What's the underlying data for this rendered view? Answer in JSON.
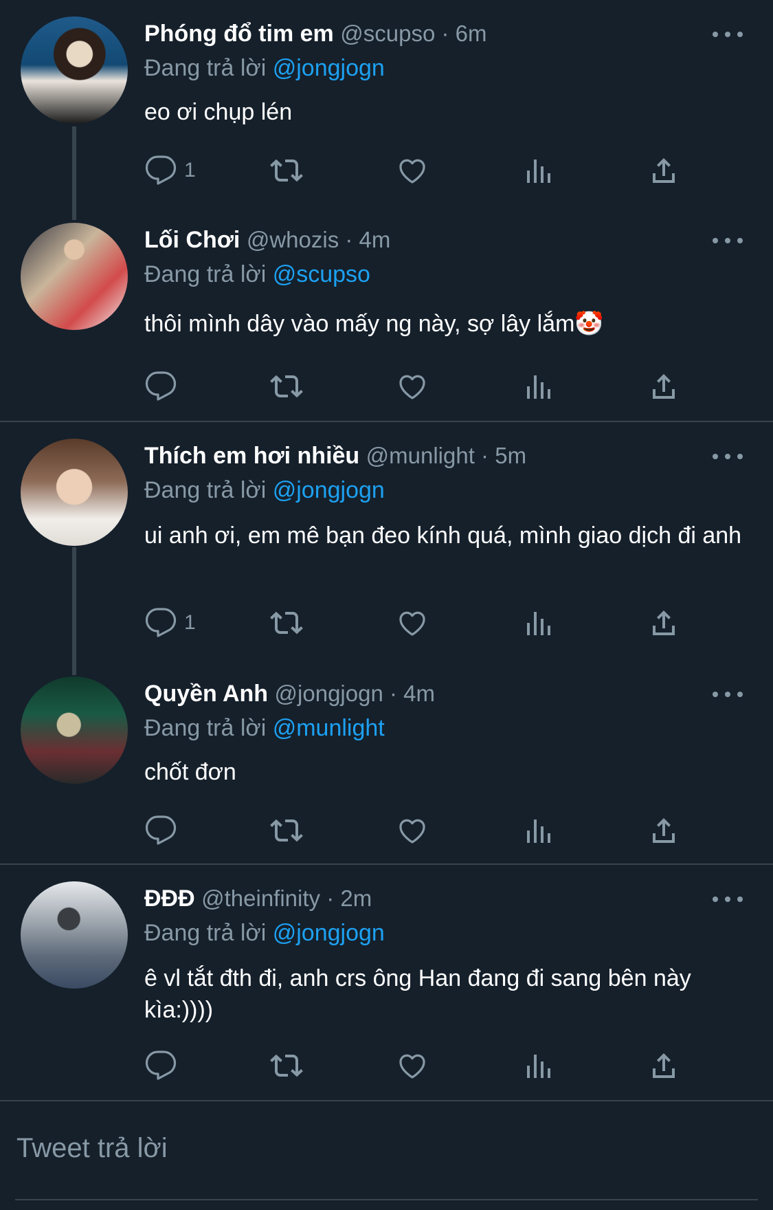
{
  "tweets": [
    {
      "name": "Phóng đổ tim em",
      "handle": "@scupso",
      "time": "6m",
      "reply_prefix": "Đang trả lời",
      "reply_to": "@jongjogn",
      "text": "eo ơi chụp lén",
      "reply_count": "1"
    },
    {
      "name": "Lối Chơi",
      "handle": "@whozis",
      "time": "4m",
      "reply_prefix": "Đang trả lời",
      "reply_to": "@scupso",
      "text": "thôi mình dây vào mấy ng này, sợ lây lắm🤡",
      "reply_count": ""
    },
    {
      "name": "Thích em hơi nhiều",
      "handle": "@munlight",
      "time": "5m",
      "reply_prefix": "Đang trả lời",
      "reply_to": "@jongjogn",
      "text": "ui anh ơi, em mê bạn đeo kính quá, mình giao dịch đi anh",
      "reply_count": "1"
    },
    {
      "name": "Quyền Anh",
      "handle": "@jongjogn",
      "time": "4m",
      "reply_prefix": "Đang trả lời",
      "reply_to": "@munlight",
      "text": "chốt đơn",
      "reply_count": ""
    },
    {
      "name": "ĐĐĐ",
      "handle": "@theinfinity",
      "time": "2m",
      "reply_prefix": "Đang trả lời",
      "reply_to": "@jongjogn",
      "text": "ê vl tắt đth đi, anh crs ông Han đang đi sang bên này kìa:))))",
      "reply_count": ""
    }
  ],
  "compose": {
    "placeholder": "Tweet trả lời"
  },
  "icons": [
    "reply-icon",
    "retweet-icon",
    "like-icon",
    "analytics-icon",
    "share-icon",
    "more-icon"
  ],
  "colors": {
    "background": "#15202b",
    "mention": "#1da1f2",
    "muted": "#8899a6",
    "divider": "#38444d"
  }
}
